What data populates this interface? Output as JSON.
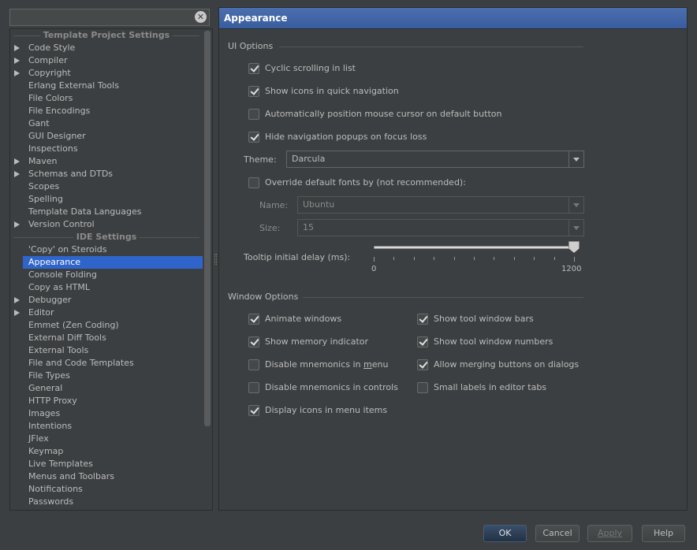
{
  "search": {
    "value": ""
  },
  "tree": {
    "sections": [
      {
        "title": "Template Project Settings",
        "items": [
          {
            "label": "Code Style",
            "expandable": true
          },
          {
            "label": "Compiler",
            "expandable": true
          },
          {
            "label": "Copyright",
            "expandable": true
          },
          {
            "label": "Erlang External Tools",
            "expandable": false
          },
          {
            "label": "File Colors",
            "expandable": false
          },
          {
            "label": "File Encodings",
            "expandable": false
          },
          {
            "label": "Gant",
            "expandable": false
          },
          {
            "label": "GUI Designer",
            "expandable": false
          },
          {
            "label": "Inspections",
            "expandable": false
          },
          {
            "label": "Maven",
            "expandable": true
          },
          {
            "label": "Schemas and DTDs",
            "expandable": true
          },
          {
            "label": "Scopes",
            "expandable": false
          },
          {
            "label": "Spelling",
            "expandable": false
          },
          {
            "label": "Template Data Languages",
            "expandable": false
          },
          {
            "label": "Version Control",
            "expandable": true
          }
        ]
      },
      {
        "title": "IDE Settings",
        "items": [
          {
            "label": "'Copy' on Steroids",
            "expandable": false
          },
          {
            "label": "Appearance",
            "expandable": false,
            "selected": true
          },
          {
            "label": "Console Folding",
            "expandable": false
          },
          {
            "label": "Copy as HTML",
            "expandable": false
          },
          {
            "label": "Debugger",
            "expandable": true
          },
          {
            "label": "Editor",
            "expandable": true
          },
          {
            "label": "Emmet (Zen Coding)",
            "expandable": false
          },
          {
            "label": "External Diff Tools",
            "expandable": false
          },
          {
            "label": "External Tools",
            "expandable": false
          },
          {
            "label": "File and Code Templates",
            "expandable": false
          },
          {
            "label": "File Types",
            "expandable": false
          },
          {
            "label": "General",
            "expandable": false
          },
          {
            "label": "HTTP Proxy",
            "expandable": false
          },
          {
            "label": "Images",
            "expandable": false
          },
          {
            "label": "Intentions",
            "expandable": false
          },
          {
            "label": "JFlex",
            "expandable": false
          },
          {
            "label": "Keymap",
            "expandable": false
          },
          {
            "label": "Live Templates",
            "expandable": false
          },
          {
            "label": "Menus and Toolbars",
            "expandable": false
          },
          {
            "label": "Notifications",
            "expandable": false
          },
          {
            "label": "Passwords",
            "expandable": false
          }
        ]
      }
    ]
  },
  "panel": {
    "title": "Appearance",
    "ui_options": {
      "title": "UI Options",
      "cyclic_scrolling": {
        "label": "Cyclic scrolling in list",
        "checked": true
      },
      "show_icons_quick_nav": {
        "label": "Show icons in quick navigation",
        "checked": true
      },
      "auto_position_cursor": {
        "label": "Automatically position mouse cursor on default button",
        "checked": false
      },
      "hide_nav_popups": {
        "label": "Hide navigation popups on focus loss",
        "checked": true
      },
      "theme": {
        "label": "Theme:",
        "value": "Darcula"
      },
      "override_fonts": {
        "label": "Override default fonts by (not recommended):",
        "checked": false
      },
      "font_name": {
        "label": "Name:",
        "value": "Ubuntu"
      },
      "font_size": {
        "label": "Size:",
        "value": "15"
      },
      "tooltip_delay": {
        "label": "Tooltip initial delay (ms):",
        "min_label": "0",
        "max_label": "1200",
        "value": 1200,
        "min": 0,
        "max": 1200
      }
    },
    "window_options": {
      "title": "Window Options",
      "animate_windows": {
        "label": "Animate windows",
        "checked": true
      },
      "show_memory": {
        "label": "Show memory indicator",
        "checked": true
      },
      "disable_mnemonics_menu": {
        "label_pre": "Disable mnemonics in ",
        "label_u": "m",
        "label_post": "enu",
        "checked": false
      },
      "disable_mnemonics_controls": {
        "label": "Disable mnemonics in controls",
        "checked": false
      },
      "display_icons_menu": {
        "label": "Display icons in menu items",
        "checked": true
      },
      "show_tool_window_bars": {
        "label": "Show tool window bars",
        "checked": true
      },
      "show_tool_window_numbers": {
        "label": "Show tool window numbers",
        "checked": true
      },
      "allow_merging_buttons": {
        "label": "Allow merging buttons on dialogs",
        "checked": true
      },
      "small_labels": {
        "label": "Small labels in editor tabs",
        "checked": false
      }
    }
  },
  "buttons": {
    "ok": "OK",
    "cancel": "Cancel",
    "apply": "Apply",
    "help": "Help"
  }
}
